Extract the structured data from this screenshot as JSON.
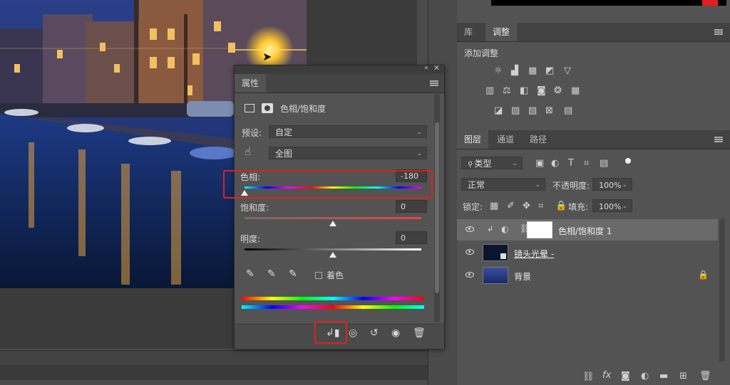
{
  "properties_panel": {
    "tab_label": "属性",
    "adjustment_title": "色相/饱和度",
    "preset_label": "预设:",
    "preset_value": "自定",
    "channel_value": "全图",
    "hue_label": "色相:",
    "hue_value": "-180",
    "hue_fraction": 0.0,
    "saturation_label": "饱和度:",
    "saturation_value": "0",
    "saturation_fraction": 0.5,
    "lightness_label": "明度:",
    "lightness_value": "0",
    "lightness_fraction": 0.5,
    "colorize_label": "着色",
    "panel_menu_glyph": "«"
  },
  "adjustments_panel": {
    "tabs": [
      "库",
      "调整"
    ],
    "active_tab": "调整",
    "add_adjustment_label": "添加调整"
  },
  "layers_panel": {
    "tabs": [
      "图层",
      "通道",
      "路径"
    ],
    "active_tab": "图层",
    "filter_kind": "类型",
    "blend_mode": "正常",
    "opacity_label": "不透明度:",
    "opacity_value": "100%",
    "lock_label": "锁定:",
    "fill_label": "填充:",
    "fill_value": "100%",
    "layers": [
      {
        "name": "色相/饱和度 1",
        "type": "adjustment"
      },
      {
        "name": "镜头光晕 -",
        "type": "pixel"
      },
      {
        "name": "背景",
        "type": "background"
      }
    ],
    "bottom_fx": "fx"
  },
  "colors": {
    "accent_red": "#e02020",
    "panel_bg": "#535353"
  }
}
